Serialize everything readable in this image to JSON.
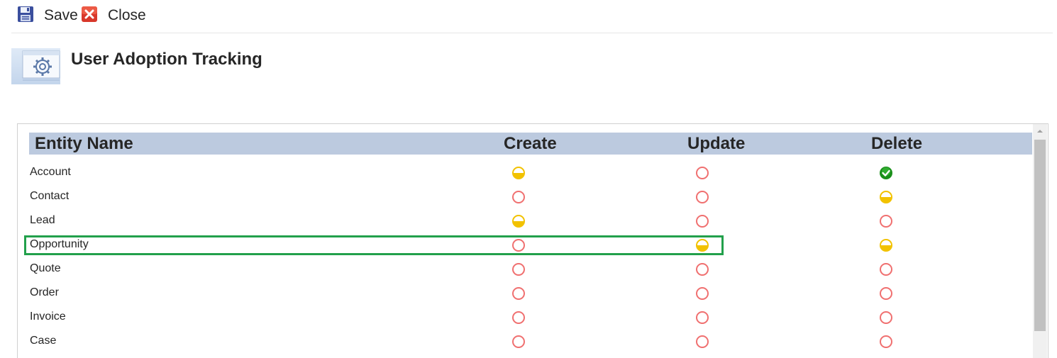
{
  "toolbar": {
    "save_label": "Save",
    "close_label": "Close"
  },
  "header": {
    "title": "User Adoption Tracking"
  },
  "grid": {
    "columns": [
      "Entity Name",
      "Create",
      "Update",
      "Delete"
    ],
    "rows": [
      {
        "name": "Account",
        "create": "partial",
        "update": "none",
        "delete": "complete"
      },
      {
        "name": "Contact",
        "create": "none",
        "update": "none",
        "delete": "partial"
      },
      {
        "name": "Lead",
        "create": "partial",
        "update": "none",
        "delete": "none"
      },
      {
        "name": "Opportunity",
        "create": "none",
        "update": "partial",
        "delete": "partial",
        "highlighted": true
      },
      {
        "name": "Quote",
        "create": "none",
        "update": "none",
        "delete": "none"
      },
      {
        "name": "Order",
        "create": "none",
        "update": "none",
        "delete": "none"
      },
      {
        "name": "Invoice",
        "create": "none",
        "update": "none",
        "delete": "none"
      },
      {
        "name": "Case",
        "create": "none",
        "update": "none",
        "delete": "none"
      }
    ]
  },
  "icons": {
    "save": "save-disk-icon",
    "close": "close-x-icon",
    "form": "settings-gear-form-icon",
    "status_none": "empty-circle-icon",
    "status_partial": "half-filled-circle-icon",
    "status_complete": "green-check-circle-icon"
  },
  "colors": {
    "status_none": "#f07070",
    "status_partial": "#f2c200",
    "status_complete": "#1a8f1a",
    "header_bg": "#bccadf",
    "highlight": "#22a04b"
  }
}
